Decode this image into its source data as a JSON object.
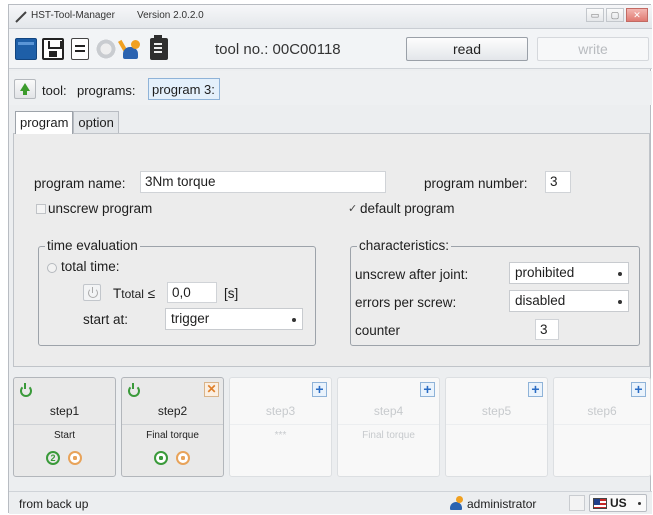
{
  "window": {
    "app_name": "HST-Tool-Manager",
    "version": "Version 2.0.2.0"
  },
  "toolbar": {
    "tool_no": "tool no.: 00C00118",
    "read_label": "read",
    "write_label": "write"
  },
  "breadcrumb": {
    "tool": "tool:",
    "programs": "programs:",
    "current": "program 3:"
  },
  "tabs": [
    {
      "label": "program",
      "active": true
    },
    {
      "label": "option",
      "active": false
    }
  ],
  "program": {
    "name_label": "program name:",
    "name_value": "3Nm torque",
    "number_label": "program number:",
    "number_value": "3",
    "unscrew_label": "unscrew program",
    "unscrew_checked": false,
    "default_label": "default program",
    "default_checked": true
  },
  "time_evaluation": {
    "title": "time evaluation",
    "total_time_label": "total time:",
    "t_label": "T",
    "t_sub": "total",
    "t_cmp": "≤",
    "t_value": "0,0",
    "t_unit": "[s]",
    "start_label": "start at:",
    "start_value": "trigger"
  },
  "characteristics": {
    "title": "characteristics:",
    "unscrew_after_label": "unscrew after joint:",
    "unscrew_after_value": "prohibited",
    "errors_label": "errors per screw:",
    "errors_value": "disabled",
    "counter_label": "counter",
    "counter_value": "3"
  },
  "steps": [
    {
      "name": "step1",
      "desc": "Start",
      "state": "active"
    },
    {
      "name": "step2",
      "desc": "Final torque",
      "state": "active"
    },
    {
      "name": "step3",
      "desc": "***",
      "state": "disabled"
    },
    {
      "name": "step4",
      "desc": "Final torque",
      "state": "disabled"
    },
    {
      "name": "step5",
      "desc": "",
      "state": "disabled"
    },
    {
      "name": "step6",
      "desc": "",
      "state": "disabled"
    }
  ],
  "status": {
    "text": "from back up",
    "user": "administrator",
    "language": "US"
  },
  "colors": {
    "accent": "#2b6cc4",
    "green": "#3a9a3a",
    "orange": "#e8a35a"
  }
}
